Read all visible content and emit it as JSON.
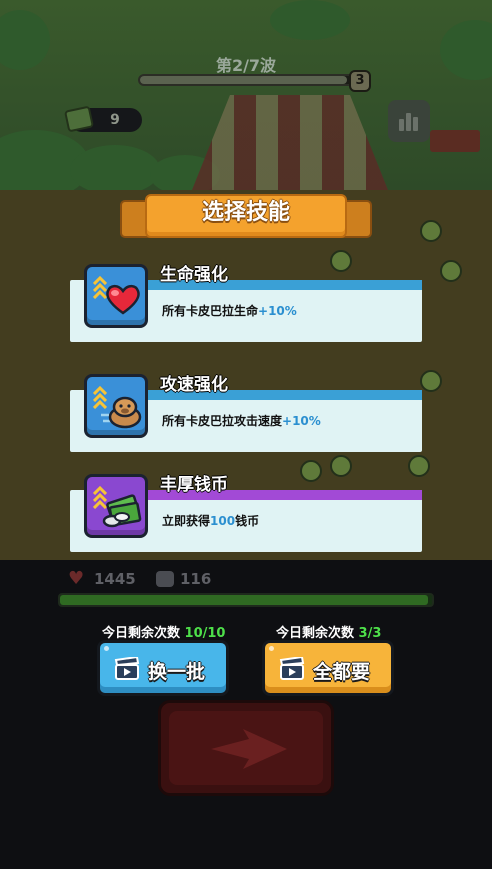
{
  "hud": {
    "wave_label": "第2/7波",
    "wave_progress": 0.95,
    "wave_end_value": "3",
    "money_count": "9"
  },
  "title": "选择技能",
  "skills": [
    {
      "name": "生命强化",
      "desc_prefix": "所有卡皮巴拉生命",
      "desc_highlight": "+10%",
      "desc_suffix": "",
      "icon": "heart-icon",
      "color": "#3aa0d6"
    },
    {
      "name": "攻速强化",
      "desc_prefix": "所有卡皮巴拉攻击速度",
      "desc_highlight": "+10%",
      "desc_suffix": "",
      "icon": "capybara-icon",
      "color": "#3aa0d6"
    },
    {
      "name": "丰厚钱币",
      "desc_prefix": "立即获得",
      "desc_highlight": "100",
      "desc_suffix": "钱币",
      "icon": "money-stack-icon",
      "color": "#a24ad6"
    }
  ],
  "player": {
    "hp": "1445",
    "armor": "116",
    "hp_fraction": 0.99
  },
  "refresh": {
    "remaining_label": "今日剩余次数",
    "remaining_value": "10/10",
    "button_label": "换一批"
  },
  "take_all": {
    "remaining_label": "今日剩余次数",
    "remaining_value": "3/3",
    "button_label": "全都要"
  },
  "colors": {
    "accent_orange": "#f4a22d",
    "button_blue": "#48b6ea",
    "button_orange": "#f7b43a",
    "highlight_blue": "#2b8fd0",
    "count_green": "#4ee04a"
  }
}
